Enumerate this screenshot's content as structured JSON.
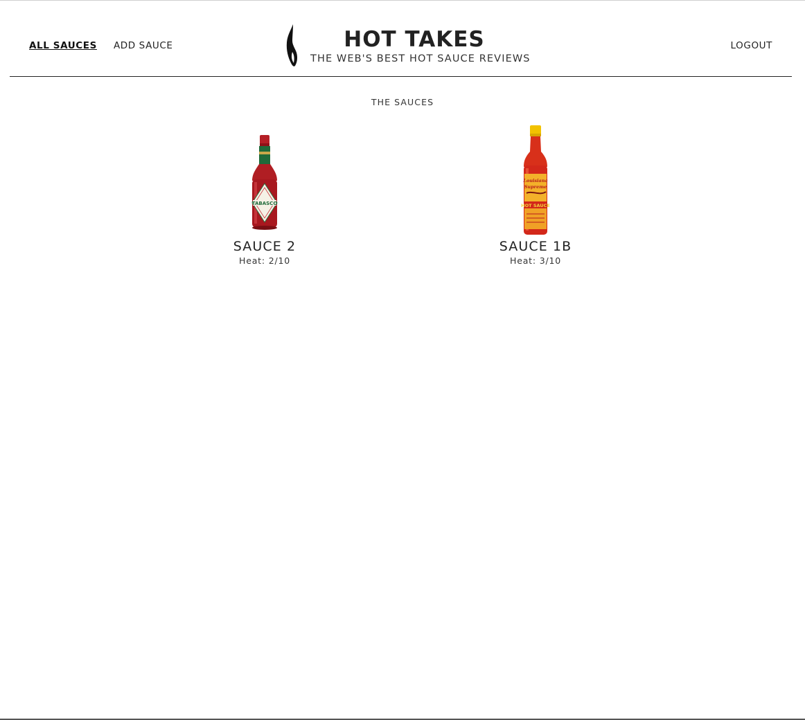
{
  "header": {
    "nav_left": [
      {
        "label": "ALL SAUCES",
        "active": true
      },
      {
        "label": "ADD SAUCE",
        "active": false
      }
    ],
    "title": "HOT TAKES",
    "subtitle": "THE WEB'S BEST HOT SAUCE REVIEWS",
    "logout_label": "LOGOUT",
    "logo_icon": "flame-icon"
  },
  "main": {
    "section_title": "THE SAUCES",
    "sauces": [
      {
        "name": "SAUCE 2",
        "heat_label": "Heat:",
        "heat_value": "2/10",
        "image": "tabasco-bottle",
        "label_text": "TABASCO"
      },
      {
        "name": "SAUCE 1B",
        "heat_label": "Heat:",
        "heat_value": "3/10",
        "image": "louisiana-hot-sauce-bottle",
        "label_text": "HOT SAUCE"
      }
    ]
  },
  "colors": {
    "text": "#222222",
    "divider": "#222222",
    "bottle_red": "#b01e23",
    "bottle_cap_yellow": "#f2c200"
  }
}
